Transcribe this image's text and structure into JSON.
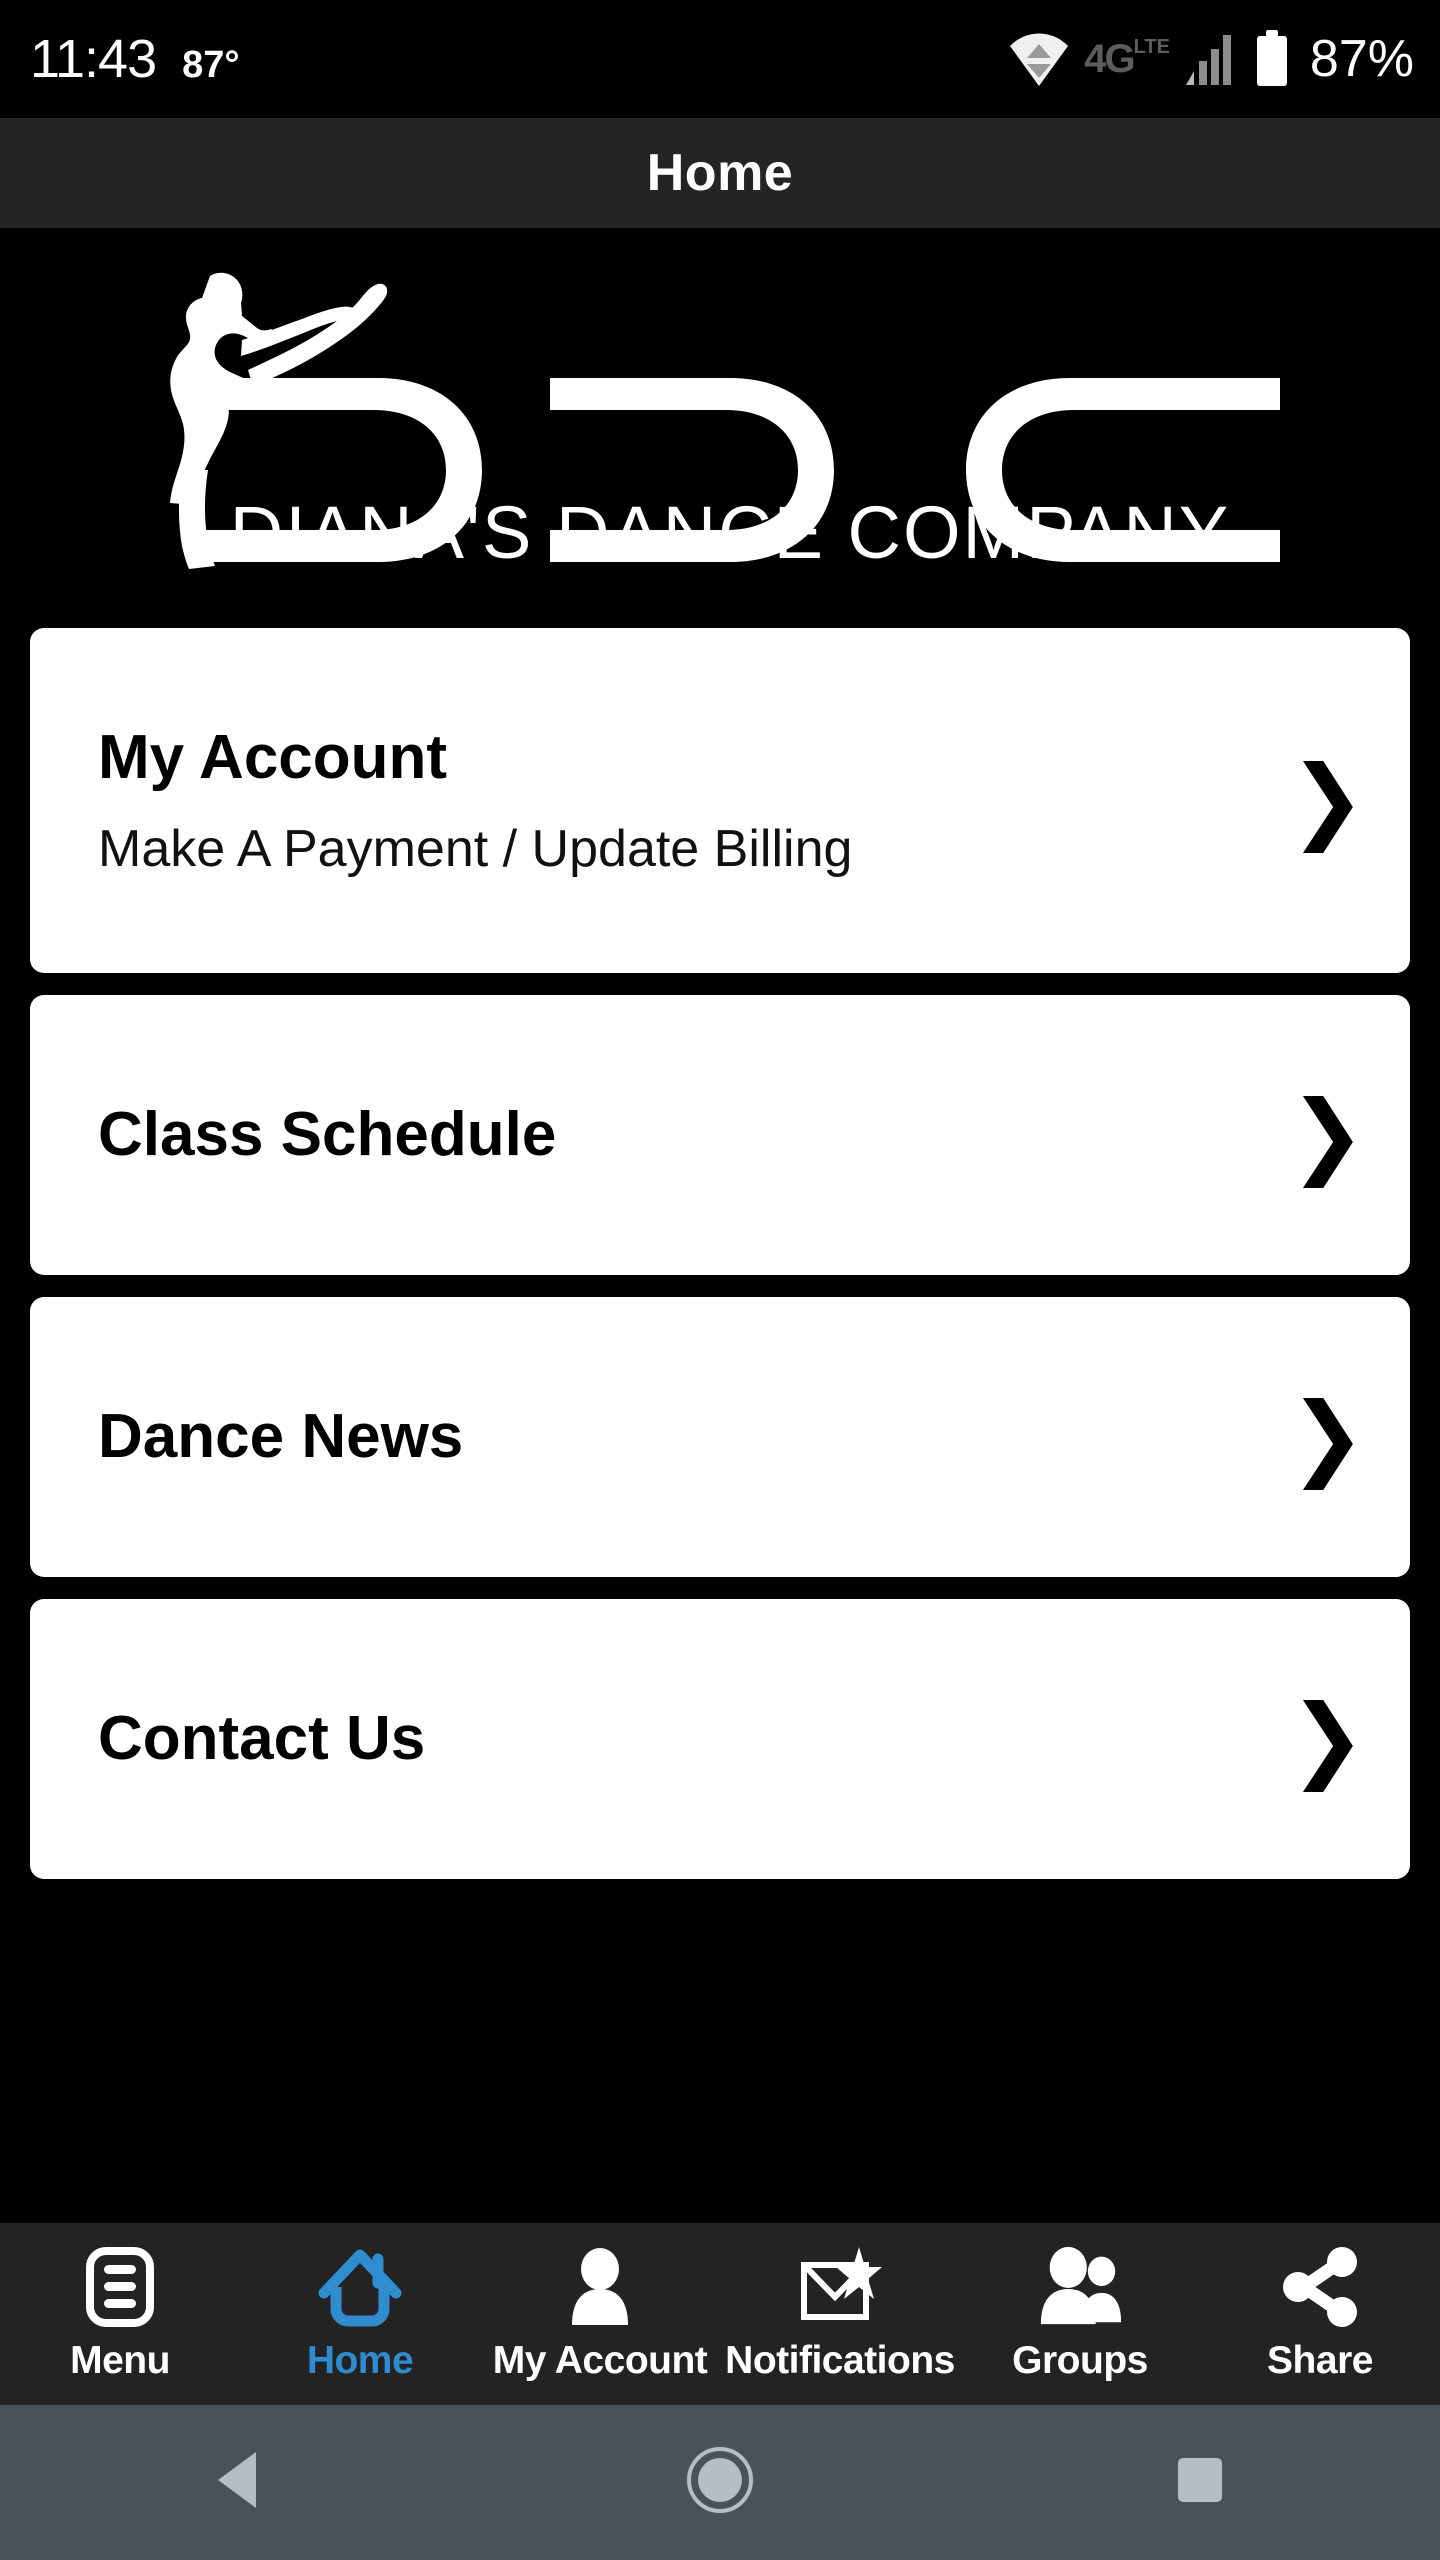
{
  "status_bar": {
    "time": "11:43",
    "temperature": "87°",
    "network_type": "4G",
    "network_sub": "LTE",
    "battery_percent": "87%",
    "icons": [
      "data-transfer-icon",
      "network-4glte-icon",
      "signal-bars-icon",
      "battery-icon"
    ]
  },
  "title_bar": {
    "title": "Home"
  },
  "logo": {
    "brand_letters": "DDC",
    "tagline": "DIANA'S DANCE COMPANY",
    "alt": "Diana's Dance Company logo with dancer silhouette"
  },
  "cards": [
    {
      "title": "My Account",
      "subtitle": "Make A Payment / Update Billing",
      "chevron": "❯"
    },
    {
      "title": "Class Schedule",
      "subtitle": "",
      "chevron": "❯"
    },
    {
      "title": "Dance News",
      "subtitle": "",
      "chevron": "❯"
    },
    {
      "title": "Contact Us",
      "subtitle": "",
      "chevron": "❯"
    }
  ],
  "tab_bar": {
    "active_color": "#2e8ccf",
    "inactive_color": "#ffffff",
    "items": [
      {
        "label": "Menu",
        "icon": "menu-list-icon",
        "active": false
      },
      {
        "label": "Home",
        "icon": "home-icon",
        "active": true
      },
      {
        "label": "My Account",
        "icon": "person-icon",
        "active": false
      },
      {
        "label": "Notifications",
        "icon": "envelope-star-icon",
        "active": false
      },
      {
        "label": "Groups",
        "icon": "people-group-icon",
        "active": false
      },
      {
        "label": "Share",
        "icon": "share-nodes-icon",
        "active": false
      }
    ]
  },
  "android_nav": {
    "buttons": [
      {
        "name": "back-button",
        "icon": "back-triangle-icon"
      },
      {
        "name": "home-button",
        "icon": "home-circle-icon"
      },
      {
        "name": "recents-button",
        "icon": "recents-square-icon"
      }
    ]
  }
}
